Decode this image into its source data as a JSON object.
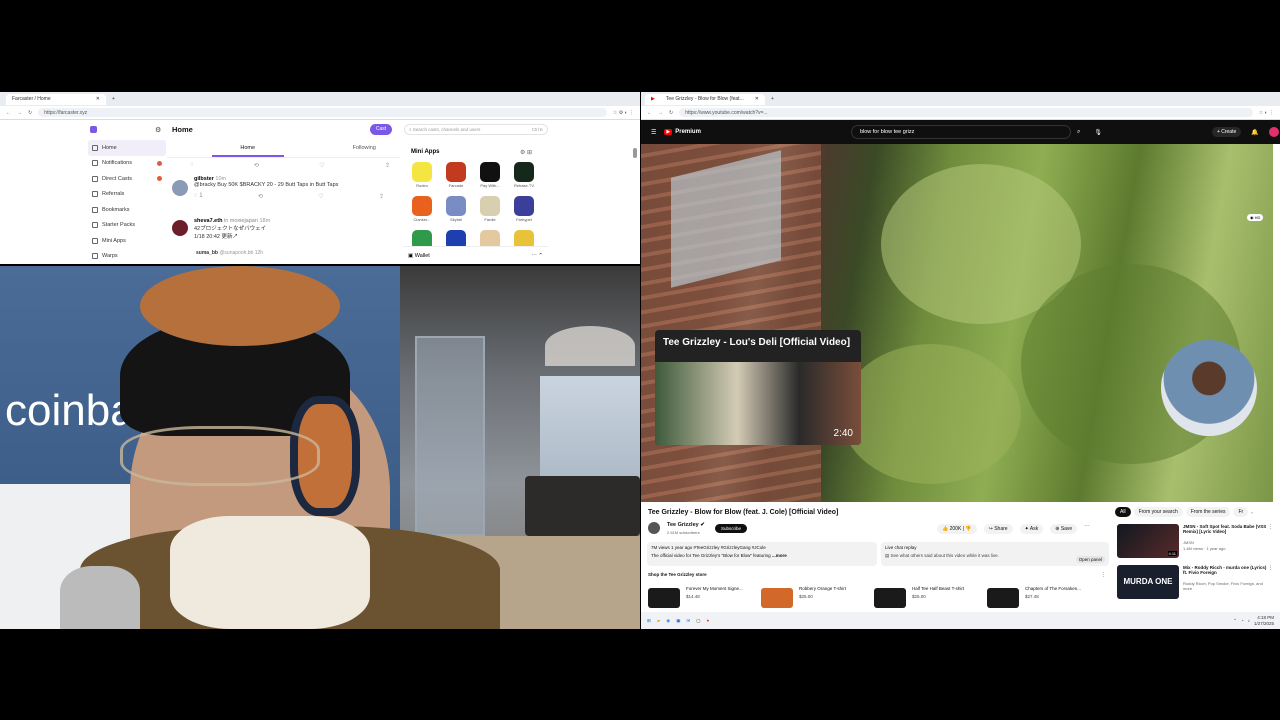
{
  "left_browser": {
    "tab_title": "Farcaster / Home",
    "url": "https://farcaster.xyz",
    "page_title": "Home",
    "cast_button": "Cast",
    "search_placeholder": "Search casts, channels and users",
    "search_shortcut": "Ctrl K",
    "feed_tabs": [
      "Home",
      "Following"
    ],
    "sidebar": [
      {
        "label": "Home",
        "badge": false
      },
      {
        "label": "Notifications",
        "badge": true
      },
      {
        "label": "Direct Casts",
        "badge": true
      },
      {
        "label": "Referrals",
        "badge": false
      },
      {
        "label": "Bookmarks",
        "badge": false
      },
      {
        "label": "Starter Packs",
        "badge": false
      },
      {
        "label": "Mini Apps",
        "badge": false
      },
      {
        "label": "Warps",
        "badge": false
      }
    ],
    "posts": [
      {
        "author": "gilbster",
        "time": "10m",
        "text": "@bracky Buy 50K $BRACKY 20 - 29 Butt Taps in Butt Taps"
      },
      {
        "author": "sheva7.eth",
        "channel": "moxiejapan",
        "time": "18m",
        "text": "42プロジェクトなぜバウェイ",
        "text2": "1/18 20:42 更新↗"
      },
      {
        "author": "suma_bb",
        "handle": "@sunapooh.bb",
        "time": "12h"
      }
    ],
    "mini_apps_title": "Mini Apps",
    "mini_apps": [
      {
        "label": "Rodeo",
        "color": "#f4e542"
      },
      {
        "label": "Farcade",
        "color": "#c23b1e"
      },
      {
        "label": "Pay With...",
        "color": "#111111"
      },
      {
        "label": "Rebase.TV",
        "color": "#16281a"
      },
      {
        "label": "Clanker...",
        "color": "#e8621e"
      },
      {
        "label": "Skyfall",
        "color": "#7a8cc4"
      },
      {
        "label": "Fardle",
        "color": "#d8cfb0"
      },
      {
        "label": "Farhypet",
        "color": "#3b3f9a"
      },
      {
        "label": "",
        "color": "#2f9a4a"
      },
      {
        "label": "",
        "color": "#1e3fb0"
      },
      {
        "label": "",
        "color": "#e3c9a0"
      },
      {
        "label": "",
        "color": "#e8c33a"
      }
    ],
    "wallet_label": "Wallet"
  },
  "right_browser": {
    "tab_title": "Tee Grizzley - Blow for Blow (feat...",
    "url": "https://www.youtube.com/watch?v=...",
    "brand": "Premium",
    "search_query": "blow for blow tee grizz",
    "create_label": "Create",
    "overlay_title": "Tee Grizzley - Lou's Deli [Official Video]",
    "overlay_duration": "2:40",
    "video_title": "Tee Grizzley - Blow for Blow (feat. J. Cole) [Official Video]",
    "channel_name": "Tee Grizzley",
    "subscribers": "2.51M subscribers",
    "subscribe_label": "Subscribe",
    "likes": "200K",
    "share_label": "Share",
    "ask_label": "Ask",
    "save_label": "Save",
    "views_line": "7M views  1 year ago  #TeeGrizzley #GrizzleyGang #JCole",
    "description": "The official video for Tee Grizzley's \"Blow for Blow\" featuring",
    "more_label": "...more",
    "live_chat_title": "Live chat replay",
    "live_chat_text": "See what others said about this video while it was live.",
    "open_panel": "Open panel",
    "store_title": "Shop the Tee Grizzley store",
    "store_items": [
      {
        "name": "Forever My Moment Signe...",
        "price": "$14.48"
      },
      {
        "name": "Robbery Orange T-shirt",
        "price": "$25.00"
      },
      {
        "name": "Half Tee Half Beast T-shirt",
        "price": "$25.00"
      },
      {
        "name": "Chapters of The Forsaken...",
        "price": "$27.48"
      }
    ],
    "chips": [
      "All",
      "From your search",
      "From the series",
      "Fr"
    ],
    "recommendations": [
      {
        "title": "JMSN - Soft Spot feat. Soda Babe (VSS Remix) [Lyric Video]",
        "channel": "JMSN",
        "meta": "1.4M views · 1 year ago",
        "duration": "4:11"
      },
      {
        "title": "Mix - Roddy Ricch - murda one (Lyrics) ft. Fivio Foreign",
        "channel": "Roddy Ricch, Pop Smoke, Fivio Foreign, and more",
        "thumb_text": "MURDA ONE"
      }
    ],
    "clock_time": "4:18 PM",
    "clock_date": "1/27/2025"
  },
  "webcam": {
    "wall_text": "coinba"
  }
}
